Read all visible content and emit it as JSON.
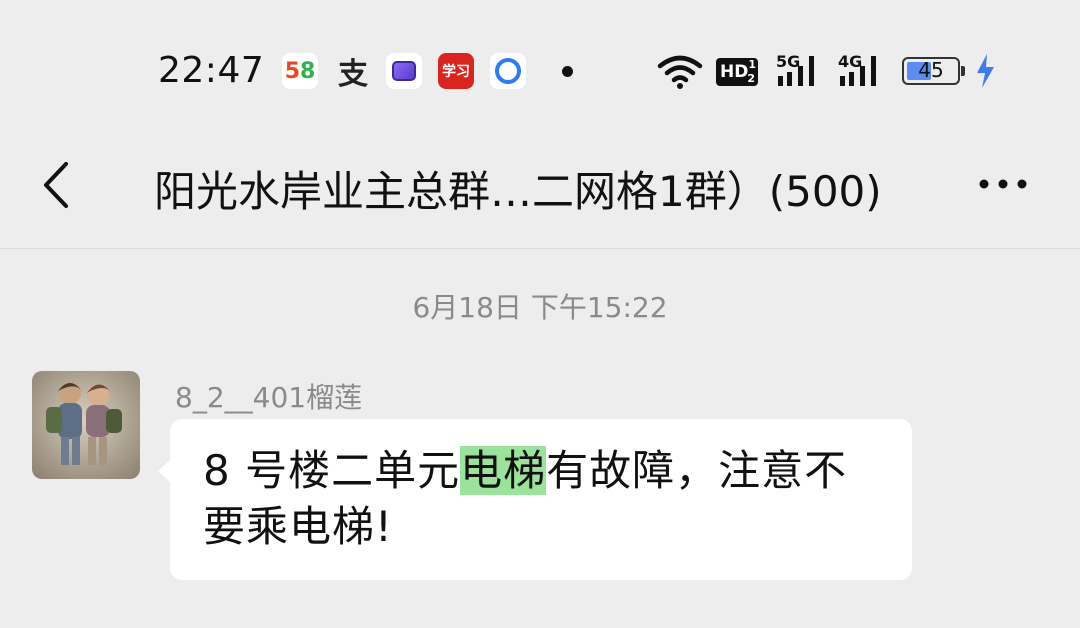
{
  "status_bar": {
    "time": "22:47",
    "icons": [
      "58-app-icon",
      "zhifubao-icon",
      "purple-app-icon",
      "xuexi-icon",
      "q-browser-icon",
      "notification-dot-icon",
      "wifi-icon",
      "hd-icon",
      "5g-signal-icon",
      "4g-signal-icon",
      "battery-icon",
      "charging-icon"
    ],
    "hd_label": "HD",
    "hd_sub": "1",
    "hd_sub2": "2",
    "net1": "5G",
    "net2": "4G",
    "battery": "45",
    "battery_level": 0.45
  },
  "header": {
    "title": "阳光水岸业主总群…二网格1群）(500)"
  },
  "chat": {
    "timestamp": "6月18日 下午15:22",
    "messages": [
      {
        "sender": "8_2__401榴莲",
        "text_before": "8 号楼二单元",
        "text_highlight": "电梯",
        "text_after": "有故障，注意不要乘电梯!"
      }
    ]
  },
  "colors": {
    "background": "#ededed",
    "bubble": "#ffffff",
    "highlight": "#9be39d",
    "muted_text": "#8a8a8a",
    "battery_fill": "#5c8cf0",
    "charging": "#3d7cf0"
  }
}
